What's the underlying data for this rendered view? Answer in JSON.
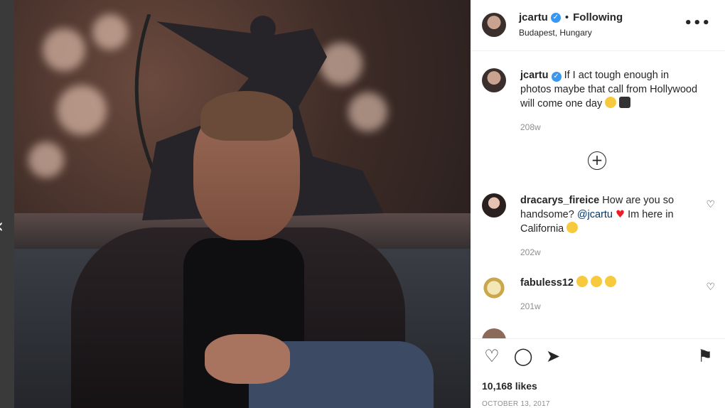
{
  "post": {
    "user": {
      "username": "jcartu",
      "location": "Budapest, Hungary",
      "follow_status": "Following",
      "verified_icon": "verified-badge-icon"
    },
    "caption": {
      "username": "jcartu",
      "text": "If I act tough enough in photos maybe that call from Hollywood will come one day",
      "time": "208w"
    },
    "comments": [
      {
        "username": "dracarys_fireice",
        "text_before": "How are you so handsome?",
        "mention": "@jcartu",
        "text_after": "Im here in California",
        "time": "202w"
      },
      {
        "username": "fabuless12",
        "time": "201w"
      }
    ],
    "likes": "10,168 likes",
    "date": "OCTOBER 13, 2017"
  },
  "icons": {
    "more": "•••",
    "load_more": "+",
    "heart": "♡",
    "comment": "◯",
    "share": "➤",
    "save": "⚑",
    "prev": "‹"
  }
}
